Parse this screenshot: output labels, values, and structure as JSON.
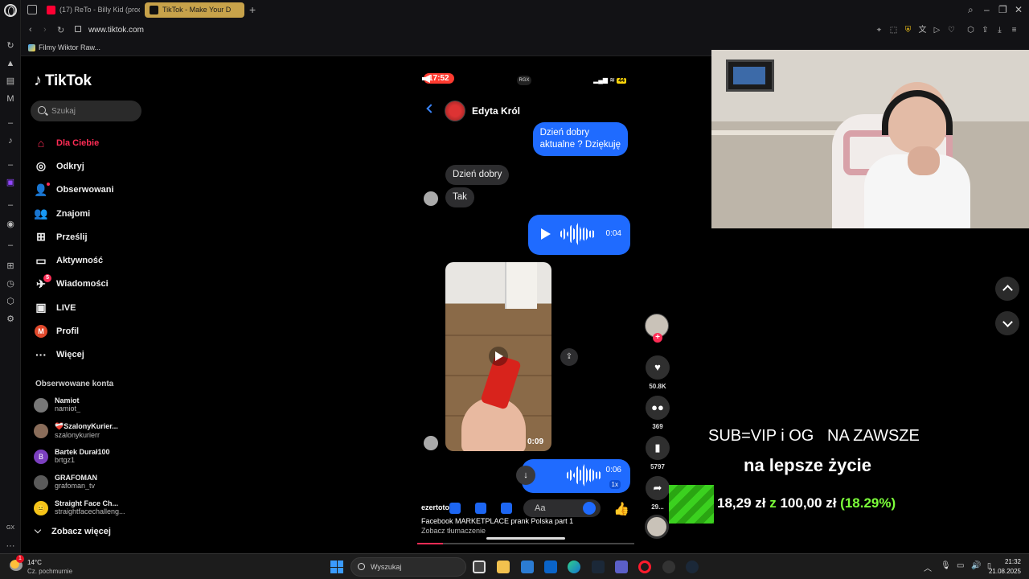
{
  "browser": {
    "tabs": [
      {
        "label": "(17) ReTo - Billy Kid (prod",
        "favicon_color": "#ff0033",
        "active": false
      },
      {
        "label": "TikTok - Make Your D",
        "favicon_color": "#111111",
        "active": true
      }
    ],
    "url": "www.tiktok.com",
    "bookmark": "Filmy Wiktor Raw..."
  },
  "tiktok": {
    "logo": "TikTok",
    "search_placeholder": "Szukaj",
    "menu": [
      {
        "label": "Dla Ciebie",
        "icon": "home-icon",
        "glyph": "⌂"
      },
      {
        "label": "Odkryj",
        "icon": "compass-icon",
        "glyph": "◎"
      },
      {
        "label": "Obserwowani",
        "icon": "following-icon",
        "glyph": "👤"
      },
      {
        "label": "Znajomi",
        "icon": "friends-icon",
        "glyph": "👥"
      },
      {
        "label": "Prześlij",
        "icon": "upload-icon",
        "glyph": "⊞"
      },
      {
        "label": "Aktywność",
        "icon": "activity-icon",
        "glyph": "▭"
      },
      {
        "label": "Wiadomości",
        "icon": "messages-icon",
        "glyph": "✈",
        "badge": "5"
      },
      {
        "label": "LIVE",
        "icon": "live-icon",
        "glyph": "▣"
      },
      {
        "label": "Profil",
        "icon": "profile-avatar",
        "glyph": "M"
      },
      {
        "label": "Więcej",
        "icon": "more-icon",
        "glyph": "···"
      }
    ],
    "following_header": "Obserwowane konta",
    "following": [
      {
        "name": "Namiot",
        "user": "namiot_",
        "av": ""
      },
      {
        "name": "❤️‍🩹SzalonyKurier...",
        "user": "szalonykurierr",
        "av": ""
      },
      {
        "name": "Bartek Durał100",
        "user": "brtgz1",
        "av": "B"
      },
      {
        "name": "GRAFOMAN",
        "user": "grafoman_tv",
        "av": ""
      },
      {
        "name": "Straight Face Ch...",
        "user": "straightfacechalleng...",
        "av": "😐"
      }
    ],
    "see_more": "Zobacz więcej"
  },
  "video": {
    "time": "17:52",
    "rgx": "RGX",
    "battery": "44",
    "chat_name": "Edyta Król",
    "msg_out_1": "Dzień dobry\naktualne ? Dziękuję",
    "msg_in_1": "Dzień dobry",
    "msg_in_2": "Tak",
    "voice_1_dur": "0:04",
    "clip_dur": "0:09",
    "voice_2_dur": "0:06",
    "voice_2_speed": "1x",
    "composer_placeholder": "Aa",
    "author": "ezertoto",
    "description": "Facebook MARKETPLACE prank Polska part 1",
    "translate": "Zobacz tłumaczenie",
    "progress": 0.12
  },
  "actions": {
    "likes": "50.8K",
    "comments": "369",
    "saves": "5797",
    "shares": "29..."
  },
  "overlay": {
    "line1": "SUB=VIP i OG   NA ZAWSZE",
    "line2": "na lepsze życie",
    "amount_current": "18,29 zł",
    "amount_sep": "z",
    "amount_goal": "100,00 zł",
    "amount_pct": "(18.29%)"
  },
  "taskbar": {
    "temp": "14°C",
    "condition": "Cz. pochmurnie",
    "weather_badge": "1",
    "search": "Wyszukaj",
    "time": "21:32",
    "date": "21.08.2025"
  }
}
